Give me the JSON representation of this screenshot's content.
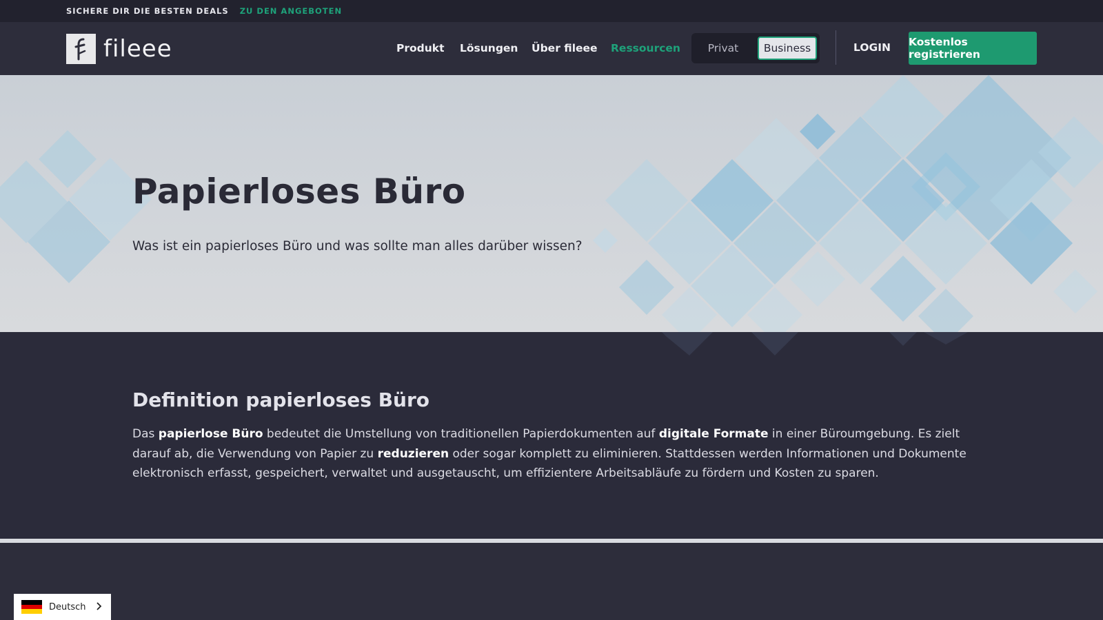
{
  "topbar": {
    "deals": "SICHERE DIR DIE BESTEN DEALS",
    "offers_link": "ZU DEN ANGEBOTEN"
  },
  "nav": {
    "logo_text": "fileee",
    "items": [
      {
        "label": "Produkt"
      },
      {
        "label": "Lösungen"
      },
      {
        "label": "Über fileee"
      },
      {
        "label": "Ressourcen",
        "active": true
      }
    ],
    "switch": {
      "privat": "Privat",
      "business": "Business",
      "selected": "Business"
    },
    "login": "LOGIN",
    "register": "Kostenlos registrieren"
  },
  "hero": {
    "title": "Papierloses Büro",
    "subtitle": "Was ist ein papierloses Büro und was sollte man alles darüber wissen?"
  },
  "definition": {
    "heading": "Definition papierloses Büro",
    "parts": [
      {
        "text": "Das ",
        "bold": false
      },
      {
        "text": "papierlose Büro",
        "bold": true
      },
      {
        "text": " bedeutet die Umstellung von traditionellen Papierdokumenten auf ",
        "bold": false
      },
      {
        "text": "digitale Formate",
        "bold": true
      },
      {
        "text": " in einer Büroumgebung. Es zielt darauf ab, die Verwendung von Papier zu ",
        "bold": false
      },
      {
        "text": "reduzieren",
        "bold": true
      },
      {
        "text": " oder sogar komplett zu eliminieren. Stattdessen werden Informationen und Dokumente elektronisch erfasst, gespeichert, verwaltet und ausgetauscht, um effizientere Arbeitsabläufe zu fördern und Kosten zu sparen.",
        "bold": false
      }
    ]
  },
  "language": {
    "label": "Deutsch",
    "flag_colors": [
      "#000000",
      "#dd0000",
      "#ffce00"
    ]
  },
  "colors": {
    "accent": "#1ea27a",
    "dark_bg": "#2b2b3a",
    "topbar_bg": "#22222e"
  }
}
